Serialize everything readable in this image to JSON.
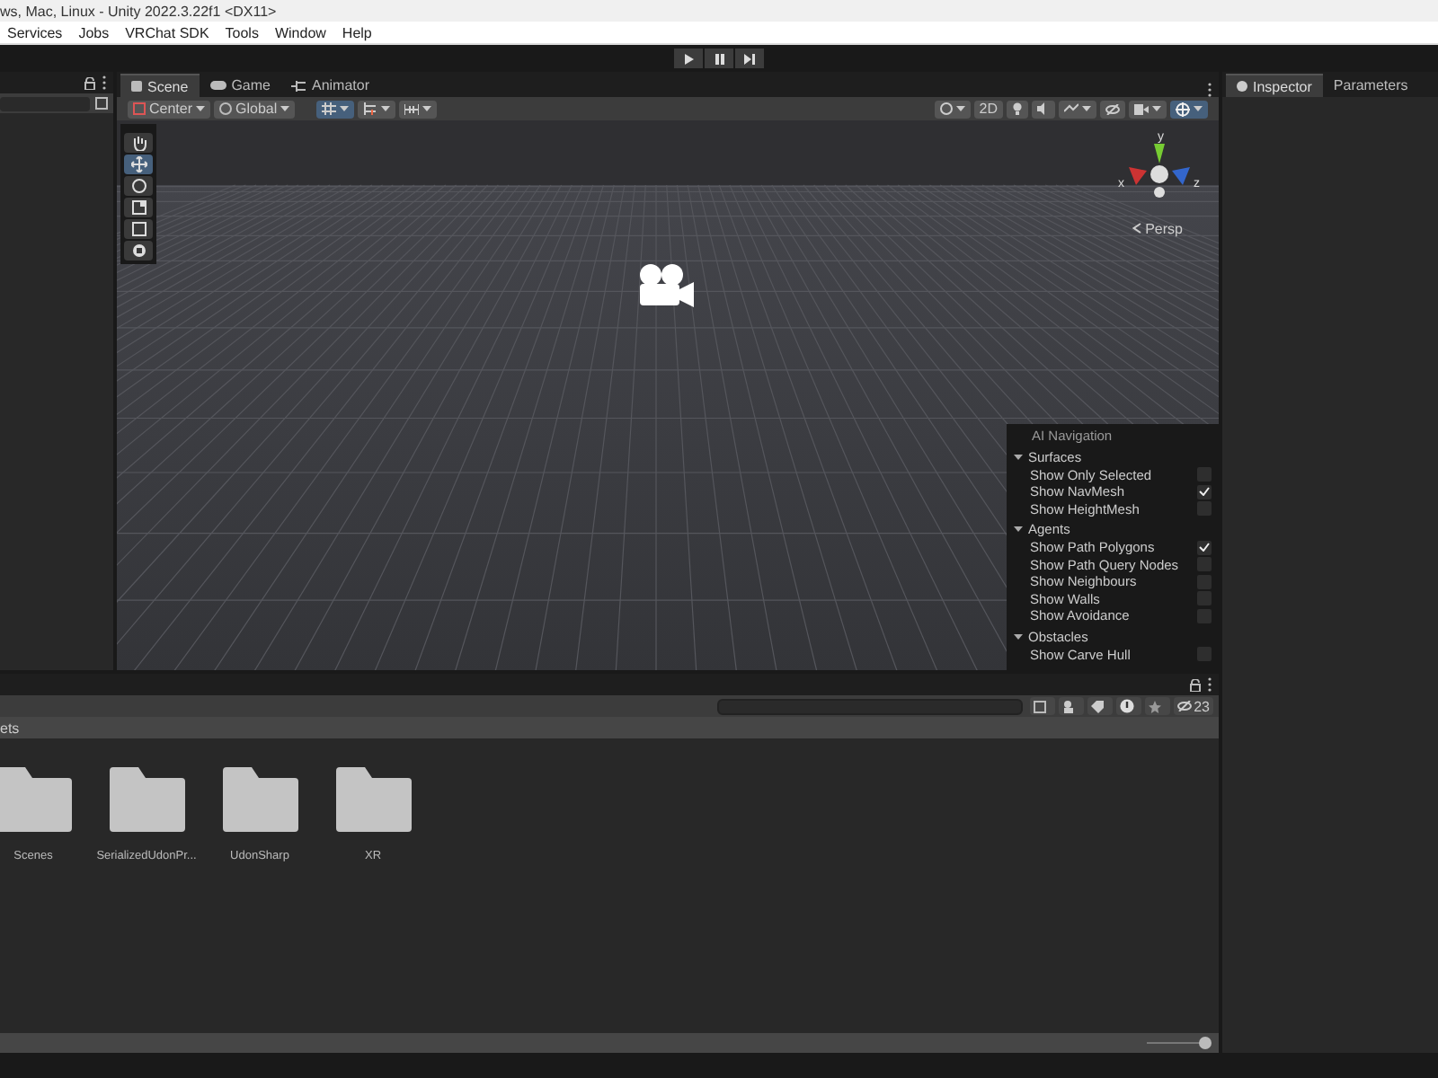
{
  "window": {
    "title": "ws, Mac, Linux - Unity 2022.3.22f1 <DX11>"
  },
  "menu": [
    "Services",
    "Jobs",
    "VRChat SDK",
    "Tools",
    "Window",
    "Help"
  ],
  "scene_tabs": [
    {
      "label": "Scene",
      "kind": "scene",
      "selected": true
    },
    {
      "label": "Game",
      "kind": "game",
      "selected": false
    },
    {
      "label": "Animator",
      "kind": "animator",
      "selected": false
    }
  ],
  "scene_toolbar": {
    "pivot": "Center",
    "space": "Global",
    "mode_2d": "2D",
    "gizmos_on": true
  },
  "tool_palette": [
    {
      "kind": "hand",
      "selected": false
    },
    {
      "kind": "move",
      "selected": true
    },
    {
      "kind": "rotate",
      "selected": false
    },
    {
      "kind": "scale",
      "selected": false
    },
    {
      "kind": "rect",
      "selected": false
    },
    {
      "kind": "transform",
      "selected": false
    }
  ],
  "orientation_gizmo": {
    "y": "y",
    "x": "x",
    "z": "z",
    "view": "Persp"
  },
  "ai_navigation": {
    "title": "AI Navigation",
    "sections": [
      {
        "title": "Surfaces",
        "expanded": true,
        "options": [
          {
            "label": "Show Only Selected",
            "checked": false
          },
          {
            "label": "Show NavMesh",
            "checked": true
          },
          {
            "label": "Show HeightMesh",
            "checked": false
          }
        ]
      },
      {
        "title": "Agents",
        "expanded": true,
        "options": [
          {
            "label": "Show Path Polygons",
            "checked": true
          },
          {
            "label": "Show Path Query Nodes",
            "checked": false
          },
          {
            "label": "Show Neighbours",
            "checked": false
          },
          {
            "label": "Show Walls",
            "checked": false
          },
          {
            "label": "Show Avoidance",
            "checked": false
          }
        ]
      },
      {
        "title": "Obstacles",
        "expanded": true,
        "options": [
          {
            "label": "Show Carve Hull",
            "checked": false
          }
        ]
      }
    ]
  },
  "inspector_tabs": [
    {
      "label": "Inspector",
      "selected": true
    },
    {
      "label": "Parameters",
      "selected": false
    }
  ],
  "project": {
    "hidden_count": "23",
    "breadcrumb": "ets",
    "folders": [
      "Scenes",
      "SerializedUdonPr...",
      "UdonSharp",
      "XR"
    ],
    "zoom": {
      "level": 1
    }
  }
}
